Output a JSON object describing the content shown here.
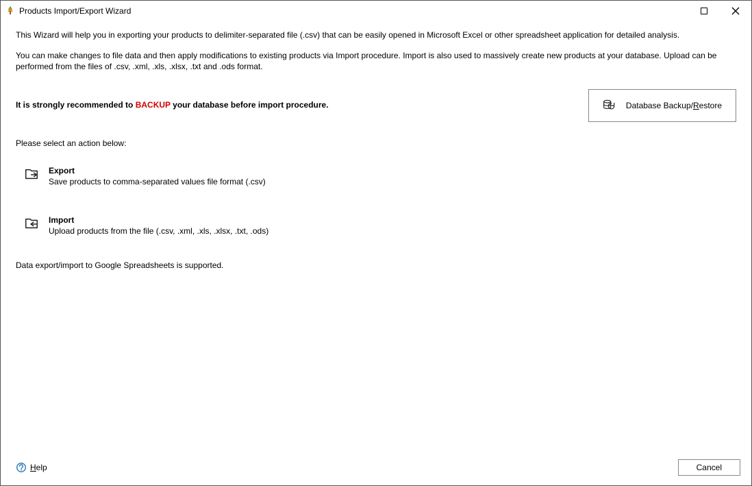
{
  "titlebar": {
    "title": "Products Import/Export Wizard"
  },
  "content": {
    "intro1": "This Wizard will help you in exporting your products to delimiter-separated file (.csv) that can be easily opened in Microsoft Excel or other spreadsheet application for detailed analysis.",
    "intro2": "You can make changes to file data and then apply modifications to existing products via Import procedure. Import is also used to massively create new products at your database. Upload can be performed from the files of .csv, .xml, .xls, .xlsx, .txt and .ods format.",
    "backup_prefix": "It is strongly recommended to ",
    "backup_word": "BACKUP",
    "backup_suffix": " your database before import procedure.",
    "backup_button": "Database Backup/Restore",
    "select_action": "Please select an action below:",
    "export": {
      "title": "Export",
      "desc": "Save products to comma-separated values file format (.csv)"
    },
    "import": {
      "title": "Import",
      "desc": "Upload products from the file (.csv, .xml, .xls, .xlsx, .txt, .ods)"
    },
    "note": "Data export/import to Google Spreadsheets is supported."
  },
  "footer": {
    "help": "Help",
    "cancel": "Cancel"
  }
}
